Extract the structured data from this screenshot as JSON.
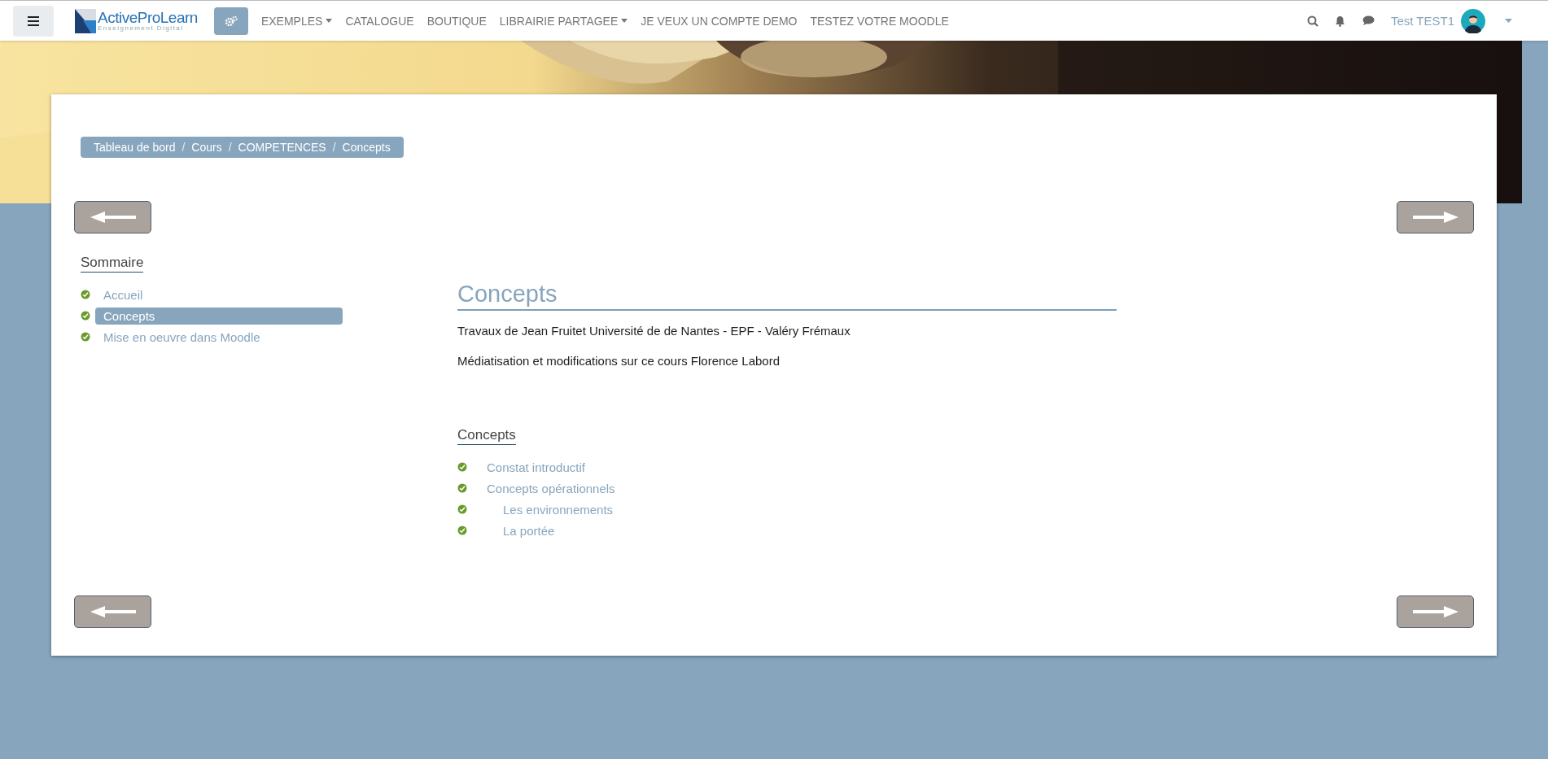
{
  "navbar": {
    "logo": {
      "name": "ActiveProLearn",
      "tagline": "Enseignement Digital"
    },
    "menu": [
      {
        "label": "EXEMPLES",
        "dropdown": true
      },
      {
        "label": "CATALOGUE",
        "dropdown": false
      },
      {
        "label": "BOUTIQUE",
        "dropdown": false
      },
      {
        "label": "LIBRAIRIE PARTAGEE",
        "dropdown": true
      },
      {
        "label": "JE VEUX UN COMPTE DEMO",
        "dropdown": false
      },
      {
        "label": "TESTEZ VOTRE MOODLE",
        "dropdown": false
      }
    ],
    "user": {
      "name": "Test TEST1"
    }
  },
  "breadcrumb": [
    {
      "label": "Tableau de bord"
    },
    {
      "separator": "/",
      "label": "Cours"
    },
    {
      "separator": "/",
      "label": "COMPETENCES"
    },
    {
      "separator": "/",
      "label": "Concepts"
    }
  ],
  "sidebar": {
    "title": "Sommaire",
    "items": [
      {
        "label": "Accueil",
        "selected": false,
        "done": true
      },
      {
        "label": "Concepts",
        "selected": true,
        "done": true
      },
      {
        "label": "Mise en oeuvre dans Moodle",
        "selected": false,
        "done": true
      }
    ]
  },
  "content": {
    "title": "Concepts",
    "paragraphs": [
      "Travaux de Jean Fruitet Université de de Nantes -  EPF - Valéry Frémaux",
      "Médiatisation et modifications sur ce cours Florence Labord"
    ],
    "toc": {
      "title": "Concepts",
      "items": [
        {
          "label": "Constat introductif",
          "done": true
        },
        {
          "label": "Concepts opérationnels",
          "done": true,
          "children": [
            {
              "label": "Les environnements",
              "done": true
            },
            {
              "label": "La portée",
              "done": true
            }
          ]
        }
      ]
    }
  }
}
